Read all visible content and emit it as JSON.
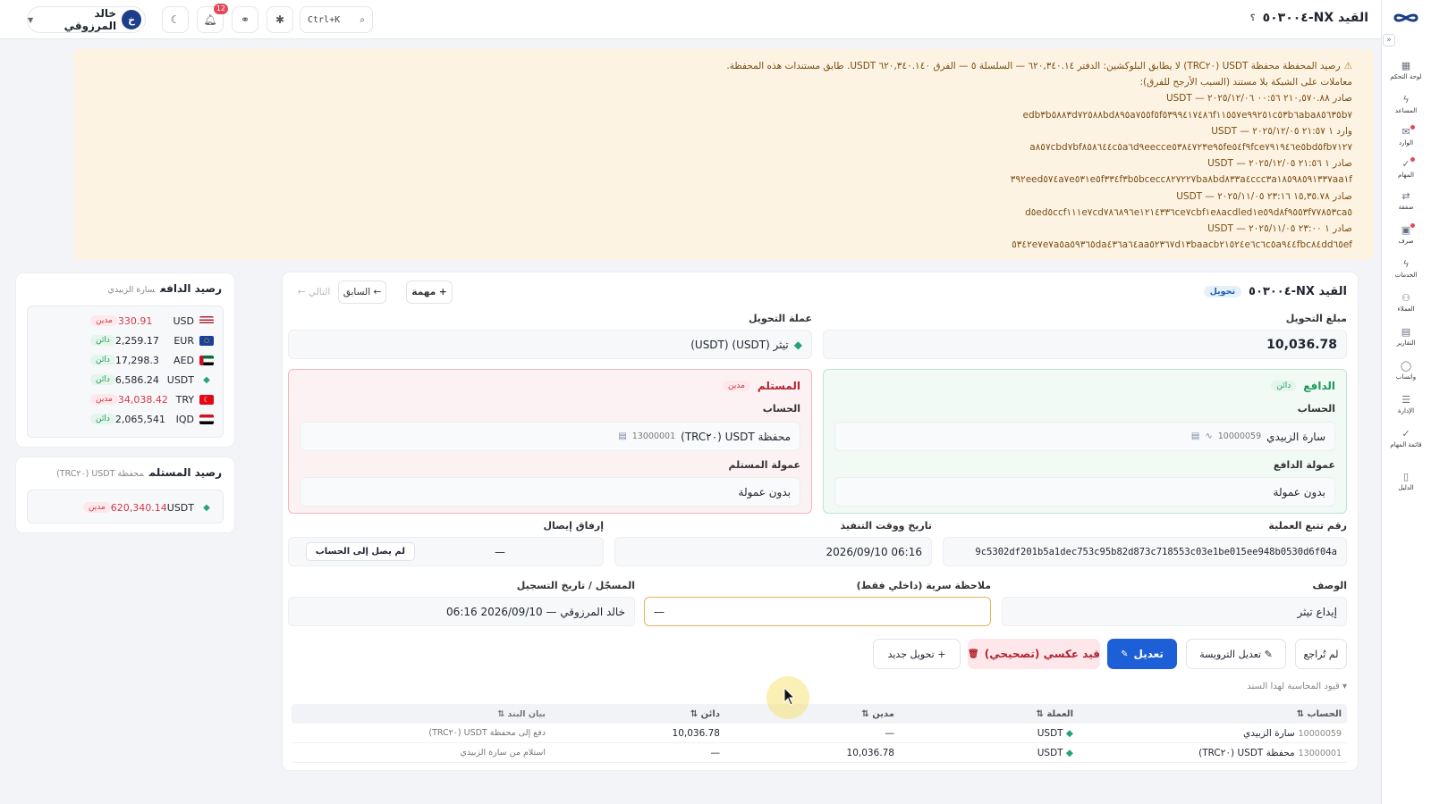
{
  "topbar": {
    "title": "القيد NX-٥٠٣٠٠٤",
    "help": "؟",
    "user_name": "خالد المرزوقي",
    "user_initial": "خ",
    "notifications_count": "12",
    "search_shortcut": "Ctrl+K"
  },
  "sidebar": {
    "items": [
      {
        "label": "لوحة التحكم",
        "icon": "dashboard-icon"
      },
      {
        "label": "المساعد",
        "icon": "bolt-icon"
      },
      {
        "label": "الوارد",
        "icon": "inbox-icon"
      },
      {
        "label": "المهام",
        "icon": "check-icon"
      },
      {
        "label": "صفقة",
        "icon": "exchange-icon"
      },
      {
        "label": "صرف",
        "icon": "cash-icon"
      },
      {
        "label": "الخدمات",
        "icon": "bolt-icon"
      },
      {
        "label": "العملاء",
        "icon": "users-icon"
      },
      {
        "label": "التقارير",
        "icon": "report-icon"
      },
      {
        "label": "واتساب",
        "icon": "chat-icon"
      },
      {
        "label": "الإدارة",
        "icon": "sliders-icon"
      },
      {
        "label": "قائمة المهام",
        "icon": "checklist-icon"
      },
      {
        "label": "الدليل",
        "icon": "book-icon"
      }
    ]
  },
  "warning": {
    "lines": [
      "رصيد المحفظة محفظة USDT (TRC٢٠) لا يطابق البلوكشين: الدفتر ٦٢٠,٣٤٠.١٤ — السلسلة ٥ — الفرق ٦٢٠,٣٤٠.١٤٠ USDT. طابق مستندات هذه المحفظة.",
      "معاملات على الشبكة بلا مستند (السبب الأرجح للفرق):",
      "صادر ٢١٠,٥٧٠.٨٨ ٠٠:٥٦ ٢٠٢٥/١٢/٠٦ — USDT",
      "edb٣b٥٨٨٣d٧٢٥٨٨bd٨٩٥a٧٥٥f٥f٥٣٩٩٤١٧٤٨٦f١١٥٥٧e٩٩٢٥١c٥٣b٦aba٨٥٦٣٥b٧",
      "وارد ١ ٢١:٥٧ ٢٠٢٥/١٢/٠٥ — USDT",
      "a٨٥٧cbd٧bf٨٥٨٦٤٤c٥a٦d٩eecce٥٣٨٤٧٢٣e٩٥fe٥٤f٩fce٧٩١٩٤٦e٥bd٥fb٧١٢٧",
      "صادر ١ ٢١:٥٦ ٢٠٢٥/١٢/٠٥ — USDT",
      "٣٩٢eed٥٧٤a٧e٥٣١e٥f٣٣٤f٣b٥bcecc٨٢٧٢٢٧ba٨bd٨٣٣a٤ccc٣a١٨٥٩٨٥٩١٣٣٧aa١f",
      "صادر ١٥,٣٥.٧٨ ٢٣:١٦ ٢٠٢٥/١١/٠٥ — USDT",
      "d٥ed٥ccf١١١e٧cd٧٨٦٨٩٦e١٢١٤٣٣٦ce٧cbf١e٨acdled١e٥٩d٨f٩٥٥٣f٧٧٨٥٣ca٥",
      "صادر ١ ٢٣:٠٠ ٢٠٢٥/١١/٠٥ — USDT",
      "٥٣٤٢e٧e٧a٥a٥٩٣٦٥da٤٣٦a٦٤aa٥٢٣٦٧d١٣baacb٢١٥٢٤e٦c٦c٥a٩٤٤fbc٨٤dd٦٥ef"
    ]
  },
  "payer_balance": {
    "title": "رصيد الدافع",
    "subtitle": "سارة الزبيدي",
    "rows": [
      {
        "currency": "USD",
        "amount": "330.91",
        "status": "مدين",
        "kind": "debit",
        "flag": "us"
      },
      {
        "currency": "EUR",
        "amount": "2,259.17",
        "status": "دائن",
        "kind": "credit",
        "flag": "eu"
      },
      {
        "currency": "AED",
        "amount": "17,298.3",
        "status": "دائن",
        "kind": "credit",
        "flag": "ae"
      },
      {
        "currency": "USDT",
        "amount": "6,586.24",
        "status": "دائن",
        "kind": "credit",
        "flag": "usdt"
      },
      {
        "currency": "TRY",
        "amount": "34,038.42",
        "status": "مدين",
        "kind": "debit",
        "flag": "tr"
      },
      {
        "currency": "IQD",
        "amount": "2,065,541",
        "status": "دائن",
        "kind": "credit",
        "flag": "iq"
      }
    ]
  },
  "receiver_balance": {
    "title": "رصيد المستلم",
    "subtitle": "محفظة USDT (TRC٢٠)",
    "rows": [
      {
        "currency": "USDT",
        "amount": "620,340.14",
        "status": "مدين",
        "kind": "debit",
        "flag": "usdt"
      }
    ]
  },
  "entry": {
    "title": "القيد NX-٥٠٣٠٠٤",
    "type_chip": "تحويل",
    "task_btn": "+ مهمة",
    "prev_btn": "← السابق",
    "next_btn": "التالي ←",
    "amount_label": "مبلغ التحويل",
    "amount_value": "10,036.78",
    "currency_label": "عملة التحويل",
    "currency_value": "تيثر (USDT) (USDT)",
    "payer": {
      "title": "الدافع",
      "badge": "دائن",
      "account_label": "الحساب",
      "account_name": "سارة الزبيدي",
      "account_no": "10000059",
      "commission_label": "عمولة الدافع",
      "commission_value": "بدون عمولة"
    },
    "receiver": {
      "title": "المستلم",
      "badge": "مدين",
      "account_label": "الحساب",
      "account_name": "محفظة USDT (TRC٢٠)",
      "account_no": "13000001",
      "commission_label": "عمولة المستلم",
      "commission_value": "بدون عمولة"
    },
    "txid_label": "رقم تتبع العملية",
    "txid_value": "9c5302df201b5a1dec753c95b82d873c718553c03e1be015ee948b0530d6f04a",
    "exec_label": "تاريخ ووقت التنفيذ",
    "exec_value": "2026/09/10 06:16",
    "receipt_label": "إرفاق إيصال",
    "receipt_btn": "لم يصل إلى الحساب",
    "receipt_dash": "—",
    "desc_label": "الوصف",
    "desc_value": "إيداع تيثر",
    "note_label": "ملاحظة سرية (داخلي فقط)",
    "note_value": "—",
    "registrar_label": "المسجّل / تاريخ التسجيل",
    "registrar_value": "خالد المرزوقي — 2026/09/10 06:16",
    "actions": {
      "not_reviewed": "لم تُراجع",
      "edit_header": "✎ تعديل الترويسة",
      "edit": "تعديل",
      "reverse": "قيد عكسي (تصحيحي)",
      "new_transfer": "+ تحويل جديد"
    },
    "ledger_toggle": "▾ قيود المحاسبة لهذا السند",
    "ledger": {
      "headers": [
        "الحساب ⇅",
        "العملة ⇅",
        "مدين ⇅",
        "دائن ⇅",
        "بيان البند ⇅"
      ],
      "rows": [
        {
          "account_no": "10000059",
          "account": "سارة الزبيدي",
          "currency": "USDT",
          "debit": "—",
          "credit": "10,036.78",
          "memo": "دفع إلى محفظة USDT (TRC٢٠)"
        },
        {
          "account_no": "13000001",
          "account": "محفظة USDT (TRC٢٠)",
          "currency": "USDT",
          "debit": "10,036.78",
          "credit": "—",
          "memo": "استلام من سارة الزبيدي"
        }
      ]
    }
  },
  "colors": {
    "accent": "#1d5fd6",
    "debit": "#d23a47",
    "credit": "#1f9a5a",
    "warning_bg": "#fdf3e3"
  }
}
